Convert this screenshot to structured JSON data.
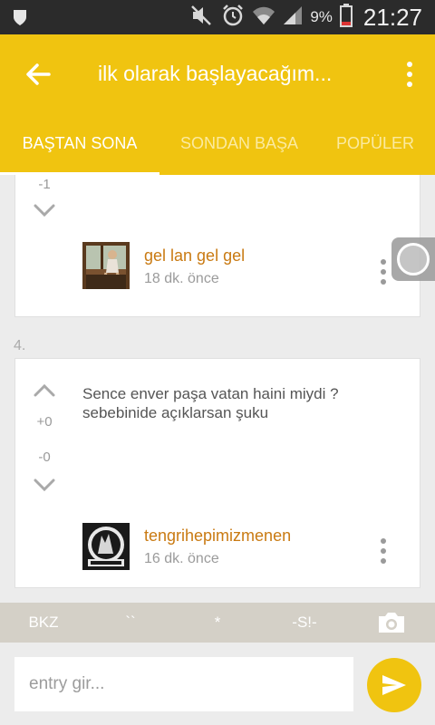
{
  "status_bar": {
    "battery_percent": "9%",
    "time": "21:27",
    "icons": [
      "notification-shield-icon",
      "mute-icon",
      "alarm-icon",
      "wifi-icon",
      "signal-icon",
      "battery-icon"
    ]
  },
  "app_bar": {
    "title": "ilk olarak başlayacağım...",
    "back_icon": "arrow-left-icon",
    "menu_icon": "more-vertical-icon"
  },
  "tabs": [
    {
      "label": "BAŞTAN SONA",
      "active": true
    },
    {
      "label": "SONDAN BAŞA",
      "active": false
    },
    {
      "label": "POPÜLER",
      "active": false
    }
  ],
  "entries": [
    {
      "score_down": "-1",
      "author": "gel lan gel gel",
      "time": "18 dk. önce",
      "avatar_icon": "user-photo-avatar"
    },
    {
      "number": "4.",
      "text": "Sence enver paşa vatan haini miydi ? sebebinide açıklarsan şuku",
      "score_up": "+0",
      "score_down": "-0",
      "author": "tengrihepimizmenen",
      "time": "16 dk. önce",
      "avatar_icon": "wolf-logo-avatar"
    }
  ],
  "toolbar": {
    "bkz": "BKZ",
    "tick": "``",
    "star": "*",
    "spoiler": "-S!-",
    "camera_icon": "camera-icon"
  },
  "compose": {
    "placeholder": "entry gir...",
    "send_icon": "send-icon"
  },
  "colors": {
    "accent": "#f0c410",
    "author": "#c97a12",
    "toolbar": "#d4d0c7",
    "status_bar": "#2b2b2b"
  }
}
